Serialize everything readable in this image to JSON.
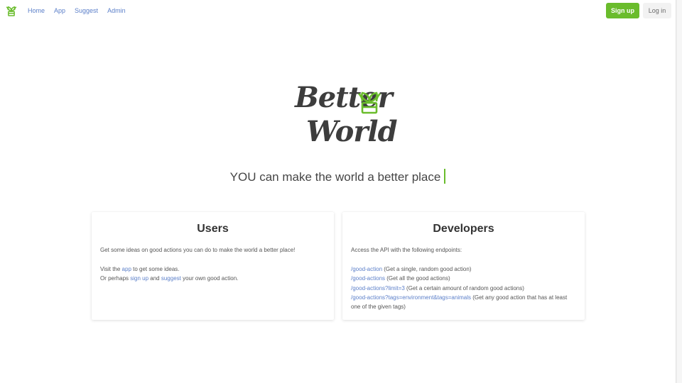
{
  "nav": {
    "links": [
      "Home",
      "App",
      "Suggest",
      "Admin"
    ],
    "signup_label": "Sign up",
    "login_label": "Log in"
  },
  "hero": {
    "logo_line1": "Better",
    "logo_line2": "World",
    "tagline": "YOU can make the world a better place"
  },
  "users_card": {
    "title": "Users",
    "intro": "Get some ideas on good actions you can do to make the world a better place!",
    "visit_prefix": "Visit the ",
    "visit_link": "app",
    "visit_suffix": " to get some ideas.",
    "perhaps_prefix": "Or perhaps ",
    "signup_link": "sign up",
    "perhaps_and": " and ",
    "suggest_link": "suggest",
    "perhaps_suffix": " your own good action."
  },
  "dev_card": {
    "title": "Developers",
    "intro": "Access the API with the following endpoints:",
    "endpoints": [
      {
        "path": "/good-action",
        "desc": " (Get a single, random good action)"
      },
      {
        "path": "/good-actions",
        "desc": " (Get all the good actions)"
      },
      {
        "path": "/good-actions?limit=3",
        "desc": " (Get a certain amount of random good actions)"
      },
      {
        "path": "/good-actions?tags=environment&tags=animals",
        "desc": " (Get any good action that has at least one of the given tags)"
      }
    ]
  },
  "colors": {
    "brand_green": "#6abc2c",
    "link_blue": "#5b7fc9",
    "text_dark": "#3d3d3d"
  }
}
